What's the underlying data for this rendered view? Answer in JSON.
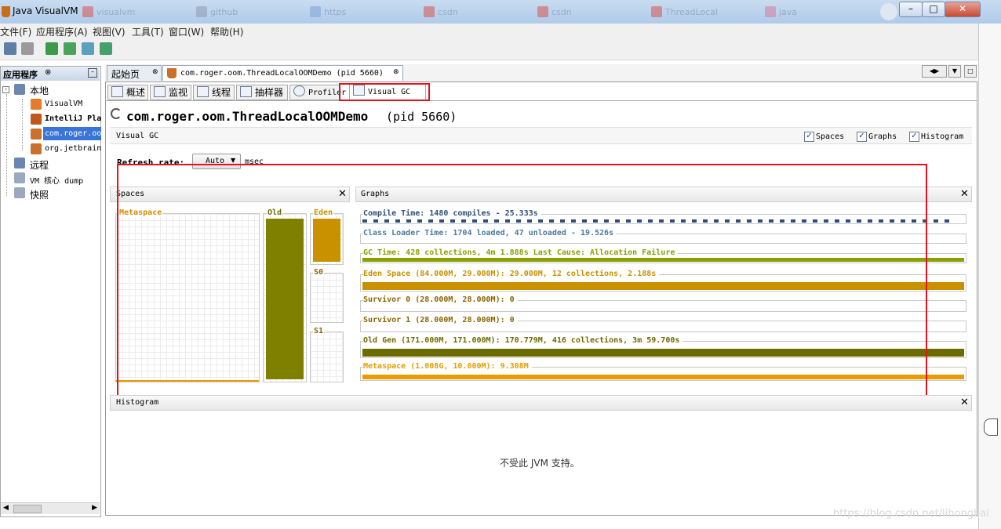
{
  "window": {
    "title": "Java VisualVM"
  },
  "menubar": {
    "items": [
      "文件(F)",
      "应用程序(A)",
      "视图(V)",
      "工具(T)",
      "窗口(W)",
      "帮助(H)"
    ]
  },
  "left_panel": {
    "title": "应用程序",
    "local": "本地",
    "local_items": [
      "VisualVM",
      "IntelliJ Pla",
      "com.roger.oo",
      "org.jetbrain"
    ],
    "remote": "远程",
    "core_dump": "VM 核心 dump",
    "snapshots": "快照"
  },
  "doc_tabs": [
    {
      "label": "起始页"
    },
    {
      "label": "com.roger.oom.ThreadLocalOOMDemo (pid 5660)"
    }
  ],
  "sub_tabs": [
    "概述",
    "监视",
    "线程",
    "抽样器",
    "Profiler",
    "Visual GC"
  ],
  "header": {
    "app_name": "com.roger.oom.ThreadLocalOOMDemo",
    "pid": "(pid 5660)",
    "section": "Visual GC",
    "checkboxes": [
      "Spaces",
      "Graphs",
      "Histogram"
    ]
  },
  "refresh": {
    "label": "Refresh rate:",
    "value": "Auto",
    "unit": "msec"
  },
  "spaces": {
    "title": "Spaces",
    "metaspace": "Metaspace",
    "old": "Old",
    "eden": "Eden",
    "s0": "S0",
    "s1": "S1",
    "levels": {
      "metaspace": 0.02,
      "old": 1.0,
      "eden": 1.0,
      "s0": 0.0,
      "s1": 0.0
    }
  },
  "graphs": {
    "title": "Graphs",
    "rows": [
      {
        "label": "Compile Time: 1480 compiles - 25.333s",
        "color": "#2f4f7a"
      },
      {
        "label": "Class Loader Time: 1704 loaded, 47 unloaded - 19.526s",
        "color": "#4b7a9e"
      },
      {
        "label": "GC Time: 428 collections, 4m 1.888s  Last Cause: Allocation Failure",
        "color": "#8aa000"
      },
      {
        "label": "Eden Space (84.000M, 29.000M): 29.000M, 12 collections, 2.188s",
        "color": "#c99100"
      },
      {
        "label": "Survivor 0 (28.000M, 28.000M): 0",
        "color": "#8c6400"
      },
      {
        "label": "Survivor 1 (28.000M, 28.000M): 0",
        "color": "#8c6400"
      },
      {
        "label": "Old Gen (171.000M, 171.000M): 170.779M, 416 collections, 3m 59.700s",
        "color": "#6b6b00"
      },
      {
        "label": "Metaspace (1.008G, 10.000M): 9.308M",
        "color": "#e89c00"
      }
    ]
  },
  "histogram": {
    "title": "Histogram",
    "message": "不受此 JVM 支持。"
  },
  "watermark": "https://blog.csdn.net/lihongbai"
}
